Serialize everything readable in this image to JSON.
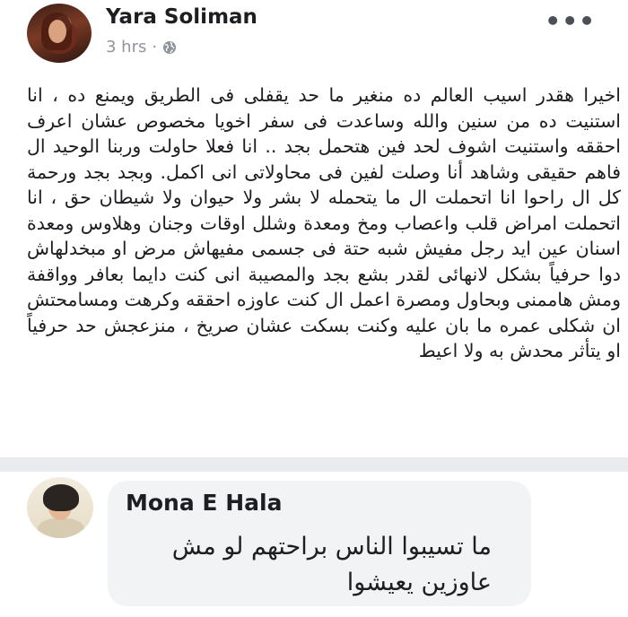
{
  "post": {
    "author": "Yara Soliman",
    "time": "3 hrs",
    "separator": "·",
    "privacy_icon": "globe-icon",
    "more_label": "•••",
    "body": "اخيرا هقدر اسيب العالم ده منغير ما حد يقفلى فى الطريق ويمنع ده ، انا استنيت ده من سنين والله وساعدت فى سفر اخويا مخصوص عشان اعرف احققه واستنيت اشوف لحد فين هتحمل بجد .. انا فعلا حاولت وربنا الوحيد ال فاهم حقيقى وشاهد أنا وصلت لفين فى محاولاتى انى اكمل. وبجد بجد ورحمة كل ال راحوا انا اتحملت ال ما يتحمله لا بشر ولا حيوان ولا شيطان حق ، انا اتحملت امراض قلب واعصاب ومخ ومعدة وشلل اوقات وجنان وهلاوس ومعدة اسنان عين ايد رجل مفيش شبه حتة فى جسمى مفيهاش مرض او مبخدلهاش دوا حرفياً بشكل لانهائى لقدر بشع بجد والمصيبة انى كنت دايما بعافر وواقفة ومش هاممنى وبحاول ومصرة اعمل ال كنت عاوزه احققه وكرهت ومسامحتش ان شكلى عمره ما بان عليه وكنت بسكت عشان صريخ ، منزعجش حد حرفياً او يتأثر محدش به ولا اعيط"
  },
  "comment": {
    "author": "Mona E Hala",
    "text": "ما تسيبوا الناس براحتهم لو مش عاوزين يعيشوا"
  }
}
